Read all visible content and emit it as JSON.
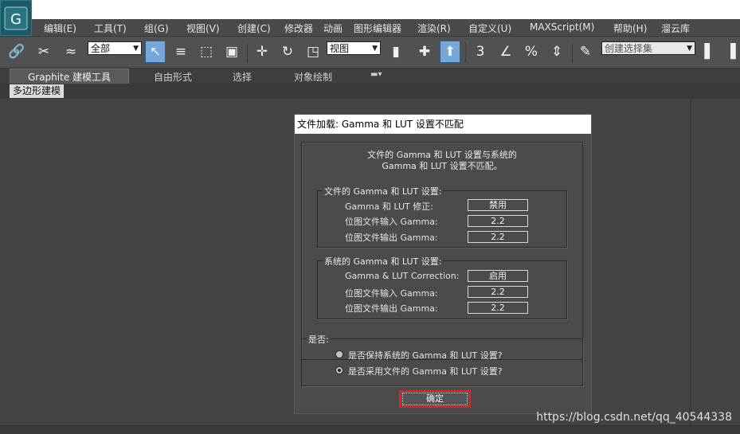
{
  "menu": {
    "items": [
      "编辑(E)",
      "工具(T)",
      "组(G)",
      "视图(V)",
      "创建(C)",
      "修改器",
      "动画",
      "图形编辑器",
      "渲染(R)",
      "自定义(U)",
      "MAXScript(M)",
      "帮助(H)",
      "溜云库"
    ]
  },
  "toolbar": {
    "selection_filter": "全部",
    "reference_coord": "视图",
    "named_selection_placeholder": "创建选择集",
    "snap_label": "3",
    "percent_label": "%"
  },
  "ribbon": {
    "tabs": [
      "Graphite 建模工具",
      "自由形式",
      "选择",
      "对象绘制"
    ],
    "subtab": "多边形建模"
  },
  "dialog": {
    "title": "文件加载: Gamma 和 LUT 设置不匹配",
    "message_line1": "文件的 Gamma 和 LUT 设置与系统的",
    "message_line2": "Gamma 和 LUT 设置不匹配。",
    "file_group": {
      "title": "文件的 Gamma 和 LUT 设置:",
      "rows": [
        {
          "label": "Gamma 和 LUT 修正:",
          "value": "禁用"
        },
        {
          "label": "位图文件输入 Gamma:",
          "value": "2.2"
        },
        {
          "label": "位图文件输出 Gamma:",
          "value": "2.2"
        }
      ]
    },
    "system_group": {
      "title": "系统的 Gamma 和 LUT 设置:",
      "rows": [
        {
          "label": "Gamma & LUT Correction:",
          "value": "启用"
        },
        {
          "label": "位图文件输入 Gamma:",
          "value": "2.2"
        },
        {
          "label": "位图文件输出 Gamma:",
          "value": "2.2"
        }
      ]
    },
    "choice": {
      "title": "是否:",
      "options": [
        "是否保持系统的 Gamma 和 LUT 设置?",
        "是否采用文件的 Gamma 和 LUT 设置?"
      ],
      "selected_index": 1
    },
    "ok_label": "确定"
  },
  "watermark": "https://blog.csdn.net/qq_40544338",
  "colors": {
    "accent": "#76a7d8",
    "highlight": "#e02525"
  }
}
